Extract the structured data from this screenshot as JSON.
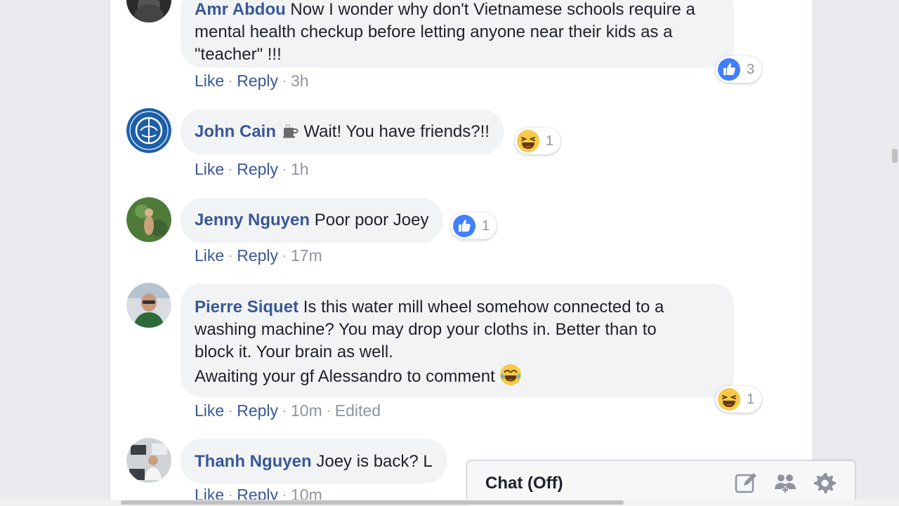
{
  "comments": [
    {
      "author": "Amr Abdou",
      "text_line1": " Now I wonder why don't Vietnamese schools require a",
      "text_line2": "mental health checkup before letting anyone near their kids as a",
      "text_line3": "\"teacher\" !!!",
      "like": "Like",
      "reply": "Reply",
      "time": "3h",
      "reaction": {
        "icon": "like-icon",
        "count": "3"
      }
    },
    {
      "author": "John Cain",
      "author_emoji": "coffee-icon",
      "text": " Wait! You have friends?!!",
      "like": "Like",
      "reply": "Reply",
      "time": "1h",
      "reaction": {
        "icon": "laughing-emoji-icon",
        "count": "1"
      }
    },
    {
      "author": "Jenny Nguyen",
      "text": " Poor poor Joey",
      "like": "Like",
      "reply": "Reply",
      "time": "17m",
      "reaction": {
        "icon": "like-icon",
        "count": "1"
      }
    },
    {
      "author": "Pierre Siquet",
      "text_line1": " Is this water mill wheel somehow connected to a",
      "text_line2": "washing machine? You may drop your cloths in. Better than to",
      "text_line3": "block it. Your brain as well.",
      "text_line4": "Awaiting your gf Alessandro to comment ",
      "text_emoji": "tears-of-joy-emoji-icon",
      "like": "Like",
      "reply": "Reply",
      "time": "10m",
      "edited": "Edited",
      "reaction": {
        "icon": "laughing-emoji-icon",
        "count": "1"
      }
    },
    {
      "author": "Thanh Nguyen",
      "text": " Joey is back? L",
      "like": "Like",
      "reply": "Reply",
      "time": "10m"
    }
  ],
  "chat": {
    "title": "Chat (Off)",
    "icons": [
      "compose-icon",
      "add-group-icon",
      "gear-icon"
    ]
  },
  "colors": {
    "link": "#385898",
    "meta": "#90949c",
    "bubble": "#f2f3f5",
    "like_blue": "#4080ff"
  }
}
